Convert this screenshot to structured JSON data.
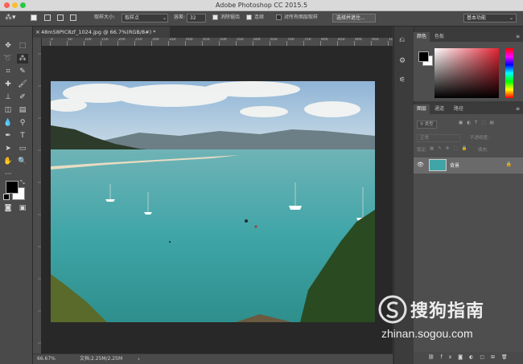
{
  "window": {
    "title": "Adobe Photoshop CC 2015.5"
  },
  "options_bar": {
    "sample_size_label": "取样大小:",
    "sample_size_value": "取样点",
    "tolerance_label": "容差:",
    "tolerance_value": "32",
    "antialias_label": "消除锯齿",
    "contiguous_label": "连续",
    "sample_all_label": "对所有图层取样",
    "select_subject_button": "选择并遮住...",
    "workspace_value": "基本功能"
  },
  "document": {
    "tab_label": "48m58PIC8zf_1024.jpg @ 66.7%(RGB/8#) *",
    "ruler_ticks": [
      "0",
      "50",
      "100",
      "150",
      "200",
      "250",
      "300",
      "350",
      "400",
      "450",
      "500",
      "550",
      "600",
      "650",
      "700",
      "750",
      "800",
      "850",
      "900",
      "950",
      "1000"
    ],
    "zoom": "66.67%",
    "doc_size": "文档:2.25M/2.25M"
  },
  "color_panel": {
    "tabs": [
      "颜色",
      "色板"
    ]
  },
  "layers_panel": {
    "tabs": [
      "图层",
      "通道",
      "路径"
    ],
    "filter_label": "类型",
    "blend_mode": "正常",
    "opacity_label": "不透明度:",
    "lock_label": "锁定:",
    "fill_label": "填充:",
    "layer_name": "背景"
  },
  "watermark": {
    "brand": "搜狗指南",
    "url": "zhinan.sogou.com"
  },
  "colors": {
    "accent": "#e93a46",
    "panel_bg": "#4e4e4e",
    "canvas_bg": "#282828"
  }
}
